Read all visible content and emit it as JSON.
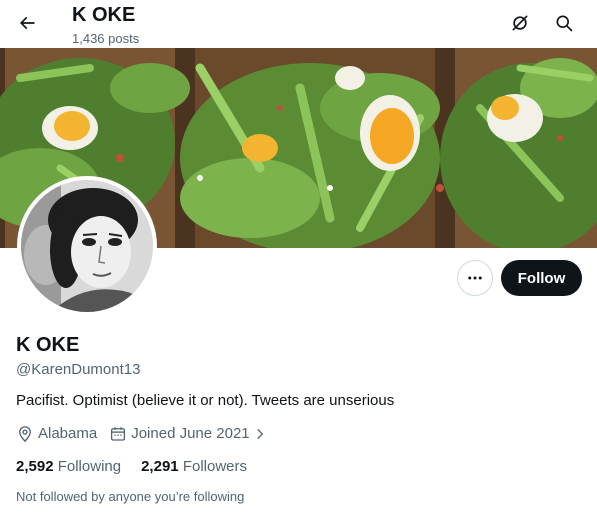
{
  "header": {
    "title": "K OKE",
    "post_count": "1,436 posts",
    "back_icon": "arrow-left-icon",
    "grok_icon": "grok-icon",
    "search_icon": "search-icon"
  },
  "profile": {
    "name": "K OKE",
    "handle": "@KarenDumont13",
    "bio": "Pacifist. Optimist (believe it or not). Tweets are unserious",
    "location": "Alabama",
    "joined": "Joined June 2021",
    "following_count": "2,592",
    "following_label": "Following",
    "followers_count": "2,291",
    "followers_label": "Followers",
    "not_followed_text": "Not followed by anyone you’re following"
  },
  "actions": {
    "follow_label": "Follow"
  },
  "colors": {
    "text_primary": "#0f1419",
    "text_secondary": "#536471",
    "follow_button_bg": "#0f1419",
    "border": "#cfd9de"
  }
}
